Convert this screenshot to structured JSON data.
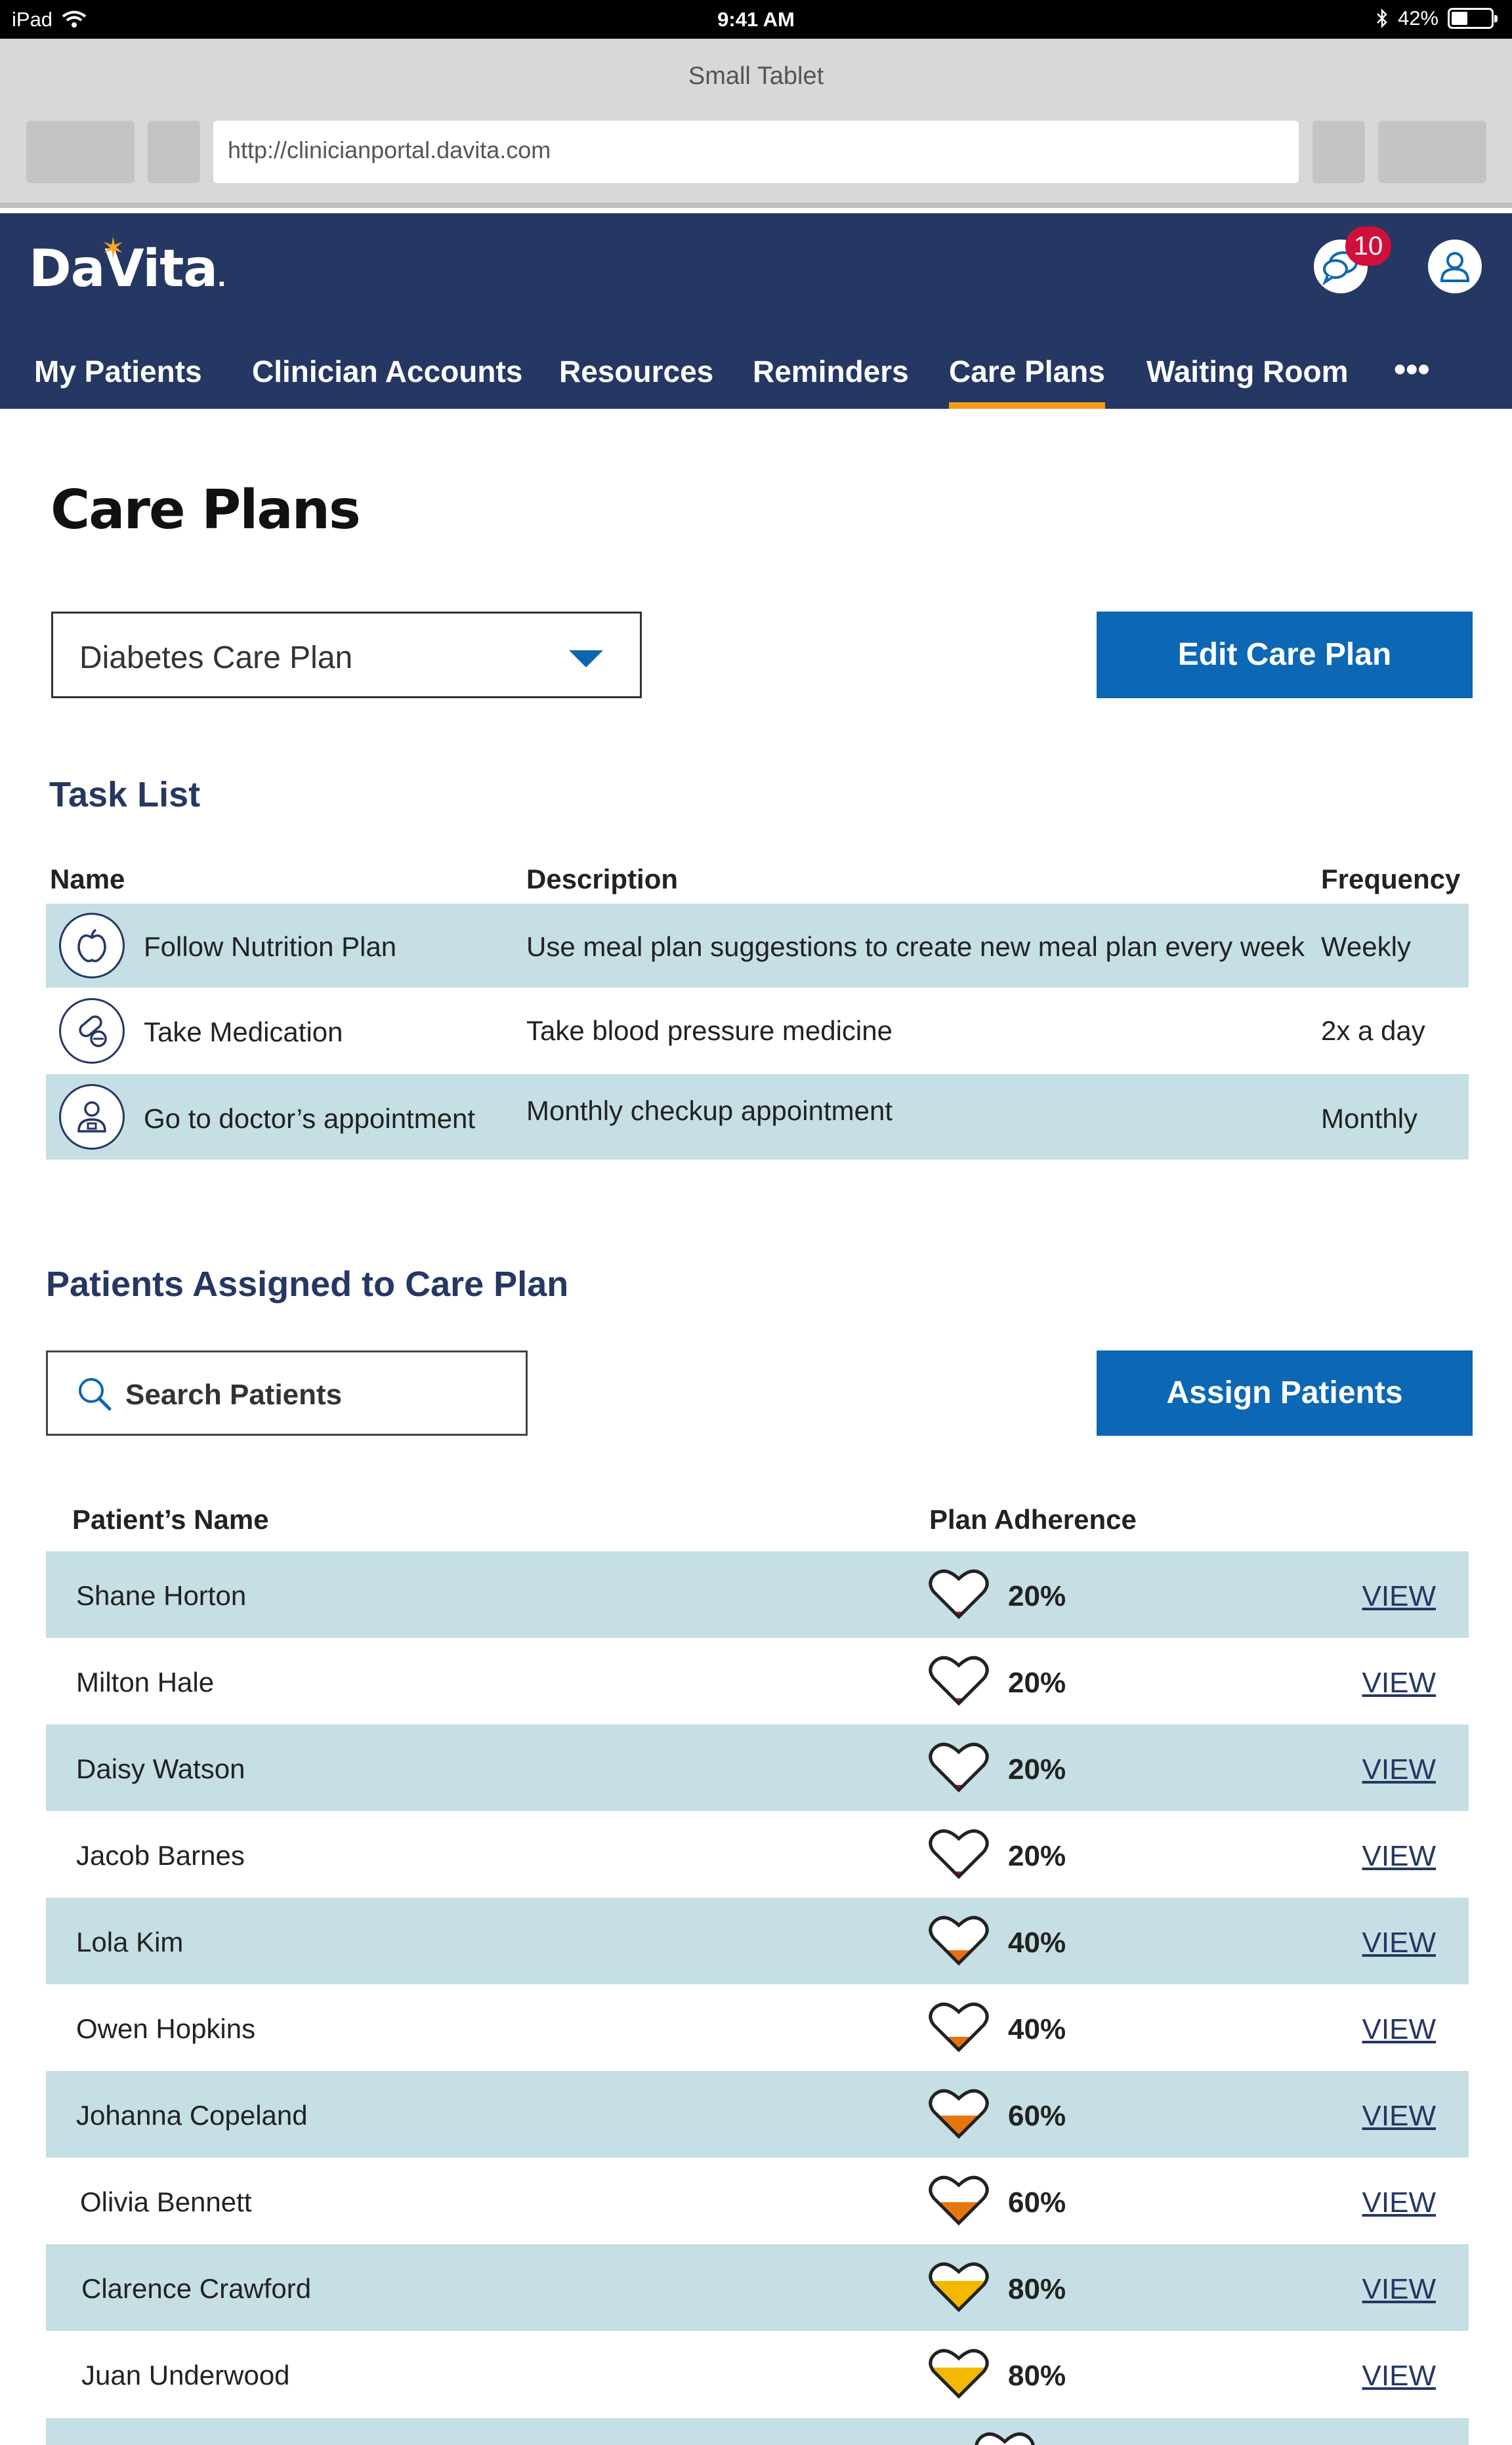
{
  "status_bar": {
    "device": "iPad",
    "time": "9:41 AM",
    "battery": "42%"
  },
  "browser": {
    "title": "Small Tablet",
    "url": "http://clinicianportal.davita.com"
  },
  "app": {
    "logo": "DaVita",
    "notification_count": "10",
    "nav": [
      {
        "label": "My Patients"
      },
      {
        "label": "Clinician Accounts"
      },
      {
        "label": "Resources"
      },
      {
        "label": "Reminders"
      },
      {
        "label": "Care Plans",
        "active": true
      },
      {
        "label": "Waiting Room"
      }
    ],
    "more": "•••"
  },
  "page": {
    "title": "Care Plans",
    "plan_select": "Diabetes Care Plan",
    "edit_button": "Edit Care Plan"
  },
  "task_list": {
    "title": "Task List",
    "headers": {
      "name": "Name",
      "description": "Description",
      "frequency": "Frequency"
    },
    "rows": [
      {
        "icon": "apple-icon",
        "name": "Follow Nutrition Plan",
        "description": "Use meal plan suggestions to create new meal plan every week",
        "frequency": "Weekly"
      },
      {
        "icon": "pill-icon",
        "name": "Take Medication",
        "description": "Take blood pressure medicine",
        "frequency": "2x a day"
      },
      {
        "icon": "doctor-icon",
        "name": "Go to doctor’s appointment",
        "description": "Monthly checkup appointment",
        "frequency": "Monthly"
      }
    ]
  },
  "patients": {
    "title": "Patients Assigned to Care Plan",
    "search_placeholder": "Search Patients",
    "assign_button": "Assign Patients",
    "headers": {
      "name": "Patient’s Name",
      "adherence": "Plan Adherence"
    },
    "view_label": "VIEW",
    "adherence_colors": {
      "20": "#c8102e",
      "40": "#e8700f",
      "60": "#e8760f",
      "80": "#f5b800"
    },
    "rows": [
      {
        "name": "Shane Horton",
        "adherence": "20%"
      },
      {
        "name": "Milton Hale",
        "adherence": "20%"
      },
      {
        "name": "Daisy Watson",
        "adherence": "20%"
      },
      {
        "name": "Jacob Barnes",
        "adherence": "20%"
      },
      {
        "name": "Lola Kim",
        "adherence": "40%"
      },
      {
        "name": "Owen Hopkins",
        "adherence": "40%"
      },
      {
        "name": "Johanna Copeland",
        "adherence": "60%"
      },
      {
        "name": "Olivia Bennett",
        "adherence": "60%"
      },
      {
        "name": "Clarence Crawford",
        "adherence": "80%"
      },
      {
        "name": "Juan Underwood",
        "adherence": "80%"
      }
    ]
  }
}
